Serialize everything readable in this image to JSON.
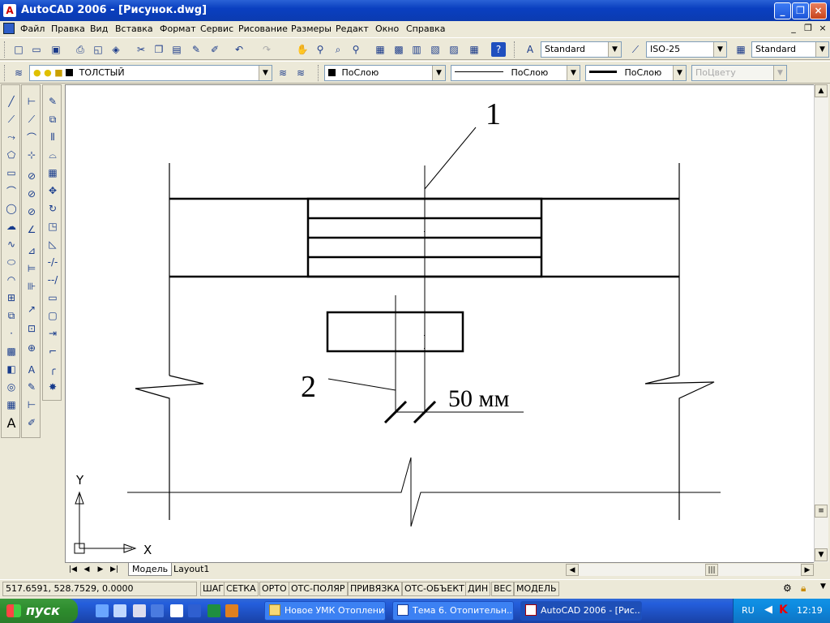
{
  "window": {
    "title": "AutoCAD 2006 - [Рисунок.dwg]",
    "minimize": "_",
    "maximize": "❐",
    "close": "×"
  },
  "menu": [
    "Файл",
    "Правка",
    "Вид",
    "Вставка",
    "Формат",
    "Сервис",
    "Рисование",
    "Размеры",
    "Редакт",
    "Окно",
    "Справка"
  ],
  "styles": {
    "text_style": "Standard",
    "dim_style": "ISO-25",
    "table_style": "Standard"
  },
  "layers": {
    "current_layer": "ТОЛСТЫЙ",
    "color": "ПоСлою",
    "linetype": "ПоСлою",
    "lineweight": "ПоСлою",
    "plot_style": "ПоЦвету"
  },
  "drawing": {
    "label_1": "1",
    "label_2": "2",
    "dimension": "50 мм",
    "ucs_x": "X",
    "ucs_y": "Y"
  },
  "tabs": [
    "Модель",
    "Layout1"
  ],
  "status": {
    "coordinates": "517.6591, 528.7529, 0.0000",
    "buttons": [
      "ШАГ",
      "СЕТКА",
      "ОРТО",
      "ОТС-ПОЛЯР",
      "ПРИВЯЗКА",
      "ОТС-ОБЪЕКТ",
      "ДИН",
      "ВЕС",
      "МОДЕЛЬ"
    ]
  },
  "taskbar": {
    "start": "пуск",
    "tasks": [
      "Новое УМК Отопление",
      "Тема 6. Отопительн...",
      "AutoCAD 2006 - [Рис..."
    ],
    "lang": "RU",
    "clock": "12:19"
  },
  "colors": {
    "title_bar": "#0a3fc0",
    "canvas": "#ffffff",
    "taskbar": "#245edc",
    "start": "#2d8b2d"
  }
}
